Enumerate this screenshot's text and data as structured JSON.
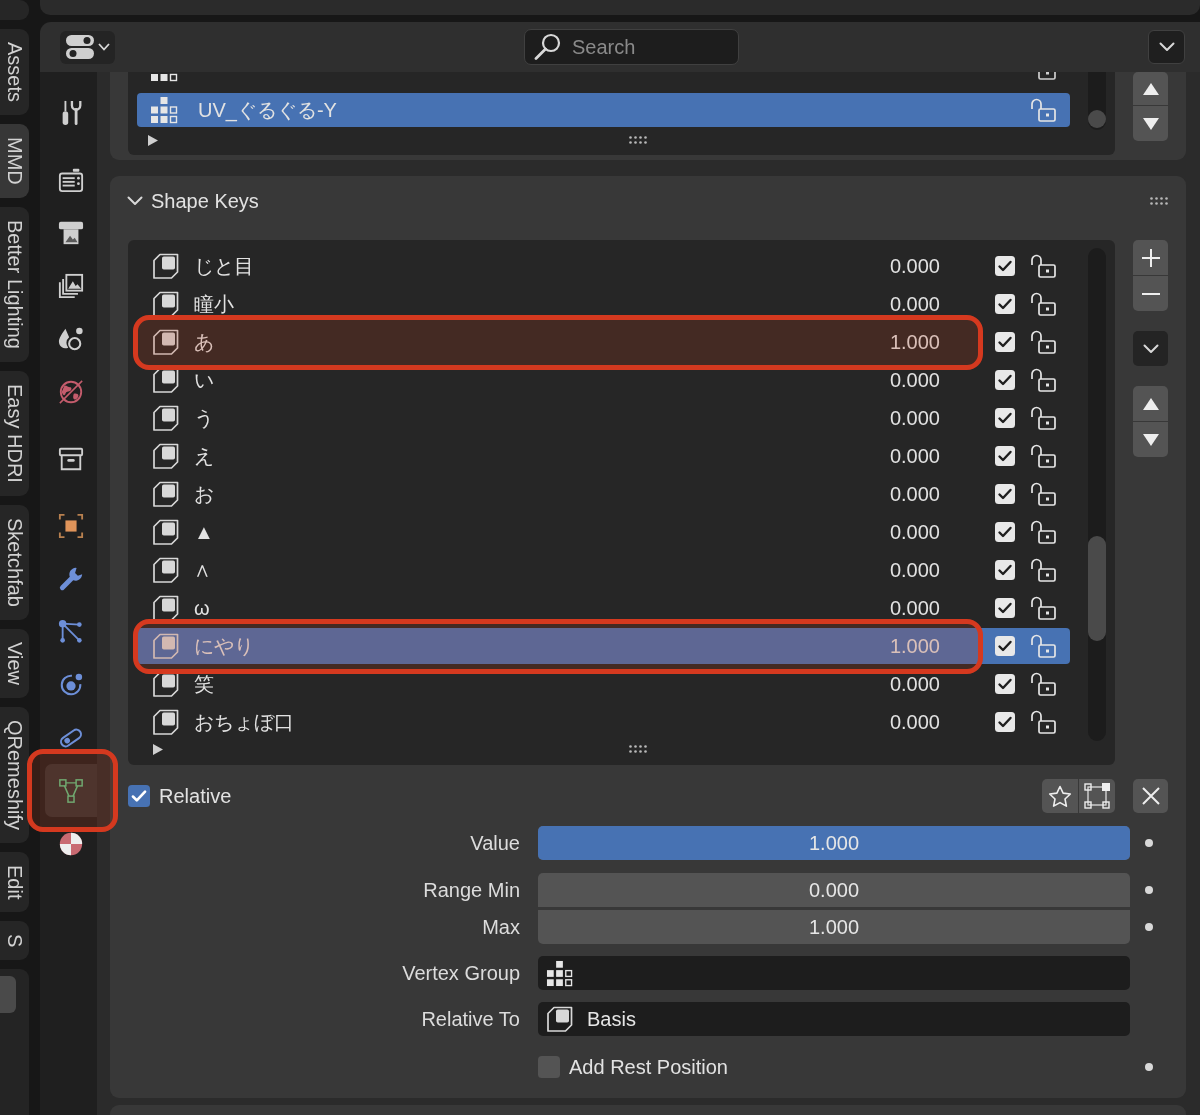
{
  "sidebar_tabs": [
    {
      "selected": false
    },
    {
      "label": "Assets",
      "selected": false
    },
    {
      "label": "MMD",
      "selected": true
    },
    {
      "label": "Better Lighting",
      "selected": false
    },
    {
      "label": "Easy HDRI",
      "selected": false
    },
    {
      "label": "Sketchfab",
      "selected": false
    },
    {
      "label": "View",
      "selected": false
    },
    {
      "label": "QRemeshify",
      "selected": false
    },
    {
      "label": "Edit",
      "selected": false
    },
    {
      "label": "S",
      "selected": false
    }
  ],
  "header": {
    "search": {
      "placeholder": "Search"
    }
  },
  "property_tabs": [
    {
      "tabs": [
        {
          "kind": "tool",
          "selected": false,
          "highlighted": false
        }
      ]
    },
    {
      "tabs": [
        {
          "kind": "render",
          "selected": false,
          "highlighted": false
        },
        {
          "kind": "output",
          "selected": false,
          "highlighted": false
        },
        {
          "kind": "view_layer",
          "selected": false,
          "highlighted": false
        },
        {
          "kind": "scene",
          "selected": false,
          "highlighted": false
        },
        {
          "kind": "world",
          "selected": false,
          "highlighted": false
        }
      ]
    },
    {
      "tabs": [
        {
          "kind": "collection",
          "selected": false,
          "highlighted": false
        }
      ]
    },
    {
      "tabs": [
        {
          "kind": "object",
          "selected": false,
          "highlighted": false
        },
        {
          "kind": "modifiers",
          "selected": false,
          "highlighted": false
        },
        {
          "kind": "particles",
          "selected": false,
          "highlighted": false
        },
        {
          "kind": "physics",
          "selected": false,
          "highlighted": false
        },
        {
          "kind": "constraints",
          "selected": false,
          "highlighted": false
        },
        {
          "kind": "data",
          "selected": true,
          "highlighted": true
        },
        {
          "kind": "material",
          "selected": false,
          "highlighted": false
        }
      ]
    }
  ],
  "uv_maps": {
    "rows": [
      {
        "selected": false
      },
      {
        "name": "UV_ぐるぐる-Y",
        "selected": true
      }
    ]
  },
  "shape_keys": {
    "title": "Shape Keys",
    "expanded": true,
    "rows": [
      {
        "name": "じと目",
        "value": "0.000",
        "checked": true,
        "selected": false,
        "highlighted": false
      },
      {
        "name": "瞳小",
        "value": "0.000",
        "checked": true,
        "selected": false,
        "highlighted": false
      },
      {
        "name": "あ",
        "value": "1.000",
        "checked": true,
        "selected": false,
        "highlighted": true
      },
      {
        "name": "い",
        "value": "0.000",
        "checked": true,
        "selected": false,
        "highlighted": false
      },
      {
        "name": "う",
        "value": "0.000",
        "checked": true,
        "selected": false,
        "highlighted": false
      },
      {
        "name": "え",
        "value": "0.000",
        "checked": true,
        "selected": false,
        "highlighted": false
      },
      {
        "name": "お",
        "value": "0.000",
        "checked": true,
        "selected": false,
        "highlighted": false
      },
      {
        "name": "▲",
        "value": "0.000",
        "checked": true,
        "selected": false,
        "highlighted": false
      },
      {
        "name": "∧",
        "value": "0.000",
        "checked": true,
        "selected": false,
        "highlighted": false
      },
      {
        "name": "ω",
        "value": "0.000",
        "checked": true,
        "selected": false,
        "highlighted": false
      },
      {
        "name": "にやり",
        "value": "1.000",
        "checked": true,
        "selected": true,
        "highlighted": true
      },
      {
        "name": "笑",
        "value": "0.000",
        "checked": true,
        "selected": false,
        "highlighted": false
      },
      {
        "name": "おちょぼ口",
        "value": "0.000",
        "checked": true,
        "selected": false,
        "highlighted": false
      }
    ],
    "relative": {
      "label": "Relative",
      "checked": true
    },
    "fields": [
      {
        "kind": "slider",
        "label": "Value",
        "value": "1.000",
        "level": 1
      },
      {
        "kind": "number",
        "label": "Range Min",
        "value": "0.000"
      },
      {
        "kind": "number",
        "label": "Max",
        "value": "1.000"
      },
      {
        "kind": "vertex_group",
        "label": "Vertex Group"
      },
      {
        "kind": "shape_key",
        "label": "Relative To",
        "value": "Basis"
      },
      {
        "kind": "checkbox",
        "label": "Add Rest Position",
        "checked": false
      }
    ]
  }
}
